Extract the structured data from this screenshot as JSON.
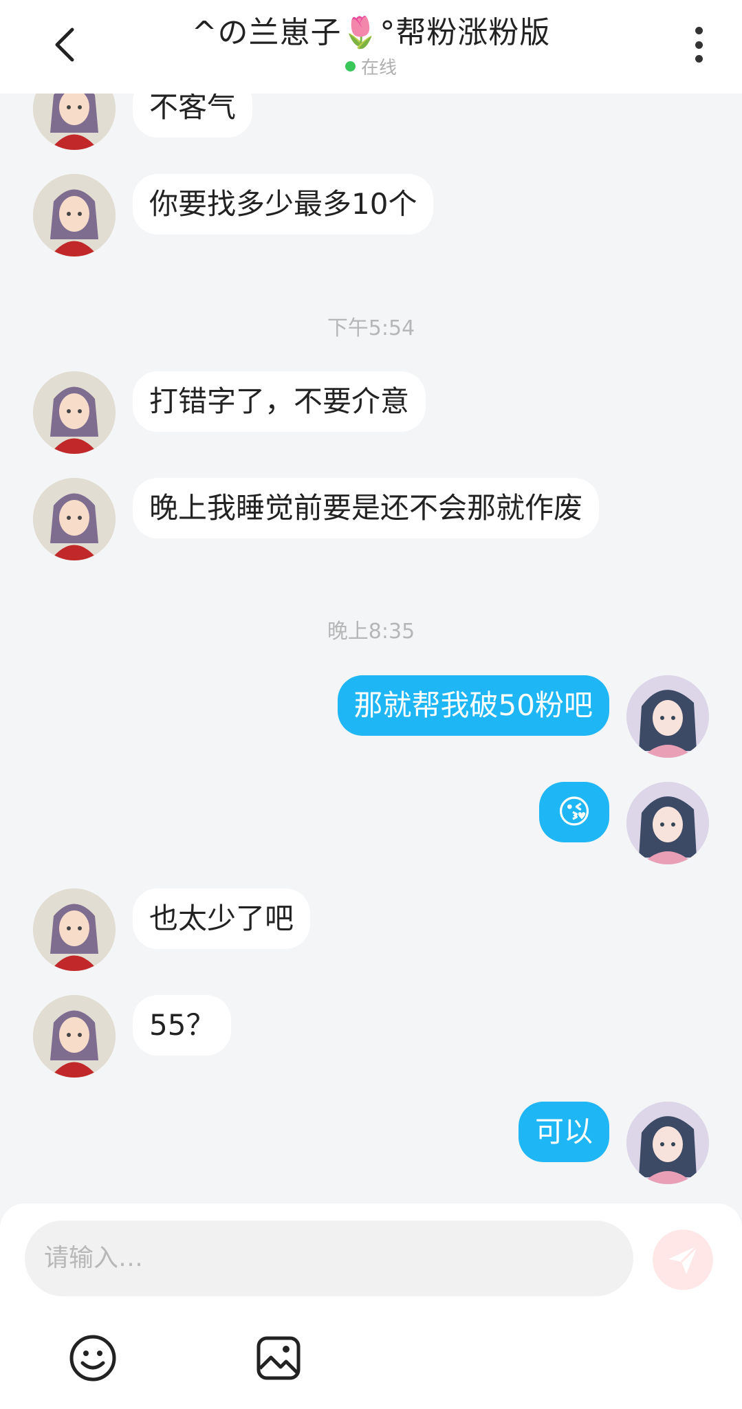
{
  "header": {
    "title": "^の兰崽子🌷°帮粉涨粉版",
    "status": "在线"
  },
  "messages": [
    {
      "side": "left",
      "text": "不客气"
    },
    {
      "side": "left",
      "text": "你要找多少最多10个"
    },
    {
      "timestamp": "下午5:54"
    },
    {
      "side": "left",
      "text": "打错字了，不要介意"
    },
    {
      "side": "left",
      "text": "晚上我睡觉前要是还不会那就作废"
    },
    {
      "timestamp": "晚上8:35"
    },
    {
      "side": "right",
      "text": "那就帮我破50粉吧"
    },
    {
      "side": "right",
      "text": "😘"
    },
    {
      "side": "left",
      "text": "也太少了吧"
    },
    {
      "side": "left",
      "text": "55？"
    },
    {
      "side": "right",
      "text": "可以"
    }
  ],
  "composer": {
    "placeholder": "请输入…"
  },
  "colors": {
    "accent": "#1fb6f5",
    "online": "#3ac75a",
    "send": "#ffe7e7"
  },
  "icons": [
    "back-arrow-icon",
    "more-vertical-icon",
    "send-icon",
    "emoji-icon",
    "image-icon"
  ]
}
